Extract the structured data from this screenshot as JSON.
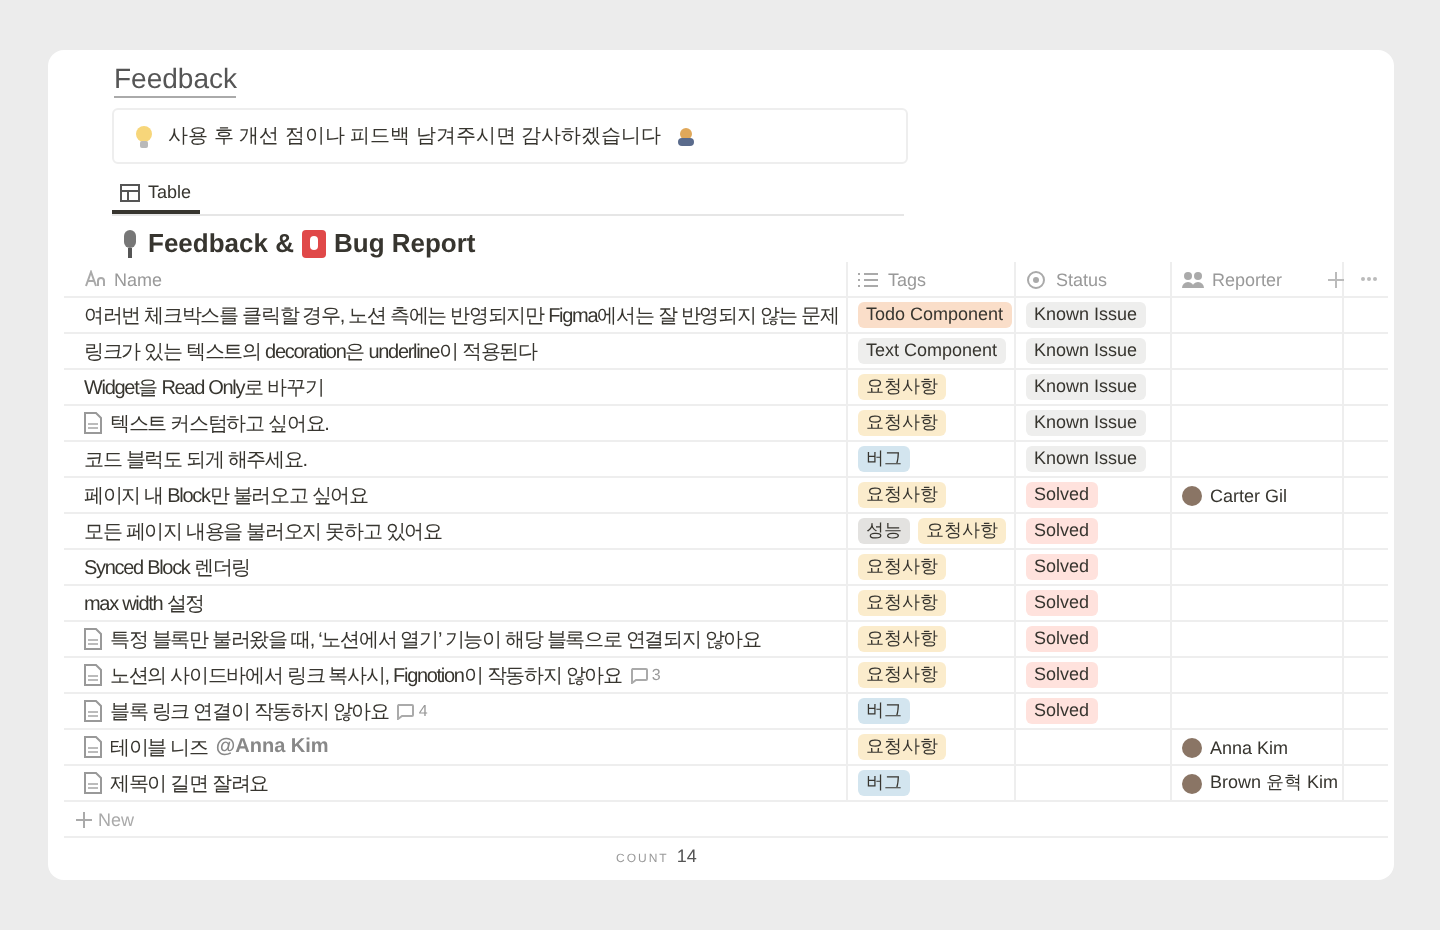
{
  "page": {
    "title": "Feedback"
  },
  "callout": {
    "text": "사용 후 개선 점이나 피드백 남겨주시면 감사하겠습니다"
  },
  "view_tabs": [
    {
      "label": "Table",
      "selected": true
    }
  ],
  "database": {
    "title_parts": [
      "Feedback &",
      "Bug Report"
    ]
  },
  "table": {
    "columns": [
      {
        "label": "Name",
        "kind": "title"
      },
      {
        "label": "Tags",
        "kind": "multi"
      },
      {
        "label": "Status",
        "kind": "status"
      },
      {
        "label": "Reporter",
        "kind": "person"
      }
    ],
    "rows": [
      {
        "name": "여러번 체크박스를 클릭할 경우, 노션 측에는 반영되지만 Figma에서는 잘 반영되지 않는 문제",
        "page_icon": false,
        "tags": [
          {
            "label": "Todo Component",
            "color": "#fadec9"
          }
        ],
        "status": {
          "label": "Known Issue",
          "color": "#eeeeed"
        }
      },
      {
        "name": "링크가 있는 텍스트의 decoration은 underline이 적용된다",
        "page_icon": false,
        "tags": [
          {
            "label": "Text Component",
            "color": "#eeeeed"
          }
        ],
        "status": {
          "label": "Known Issue",
          "color": "#eeeeed"
        }
      },
      {
        "name": "Widget을 Read Only로 바꾸기",
        "page_icon": false,
        "tags": [
          {
            "label": "요청사항",
            "color": "#fbeccc"
          }
        ],
        "status": {
          "label": "Known Issue",
          "color": "#eeeeed"
        }
      },
      {
        "name": "텍스트 커스텀하고 싶어요.",
        "page_icon": true,
        "tags": [
          {
            "label": "요청사항",
            "color": "#fbeccc"
          }
        ],
        "status": {
          "label": "Known Issue",
          "color": "#eeeeed"
        }
      },
      {
        "name": "코드 블럭도 되게 해주세요.",
        "page_icon": false,
        "tags": [
          {
            "label": "버그",
            "color": "#d3e5ef"
          }
        ],
        "status": {
          "label": "Known Issue",
          "color": "#eeeeed"
        }
      },
      {
        "name": "페이지 내 Block만 불러오고 싶어요",
        "page_icon": false,
        "tags": [
          {
            "label": "요청사항",
            "color": "#fbeccc"
          }
        ],
        "status": {
          "label": "Solved",
          "color": "#ffe2dd"
        },
        "reporter": {
          "name": "Carter Gil"
        }
      },
      {
        "name": "모든 페이지 내용을 불러오지 못하고 있어요",
        "page_icon": false,
        "tags": [
          {
            "label": "성능",
            "color": "#e3e2e0"
          },
          {
            "label": "요청사항",
            "color": "#fbeccc"
          }
        ],
        "status": {
          "label": "Solved",
          "color": "#ffe2dd"
        }
      },
      {
        "name": "Synced Block 렌더링",
        "page_icon": false,
        "tags": [
          {
            "label": "요청사항",
            "color": "#fbeccc"
          }
        ],
        "status": {
          "label": "Solved",
          "color": "#ffe2dd"
        }
      },
      {
        "name": "max width 설정",
        "page_icon": false,
        "tags": [
          {
            "label": "요청사항",
            "color": "#fbeccc"
          }
        ],
        "status": {
          "label": "Solved",
          "color": "#ffe2dd"
        }
      },
      {
        "name": "특정 블록만 불러왔을 때, ‘노션에서 열기’ 기능이 해당 블록으로 연결되지 않아요",
        "page_icon": true,
        "tags": [
          {
            "label": "요청사항",
            "color": "#fbeccc"
          }
        ],
        "status": {
          "label": "Solved",
          "color": "#ffe2dd"
        }
      },
      {
        "name": "노션의 사이드바에서 링크 복사시, Fignotion이 작동하지 않아요",
        "page_icon": true,
        "comments": "3",
        "tags": [
          {
            "label": "요청사항",
            "color": "#fbeccc"
          }
        ],
        "status": {
          "label": "Solved",
          "color": "#ffe2dd"
        }
      },
      {
        "name": "블록 링크 연결이 작동하지 않아요",
        "page_icon": true,
        "comments": "4",
        "tags": [
          {
            "label": "버그",
            "color": "#d3e5ef"
          }
        ],
        "status": {
          "label": "Solved",
          "color": "#ffe2dd"
        }
      },
      {
        "name": "테이블 니즈",
        "mention": "@Anna Kim",
        "page_icon": true,
        "tags": [
          {
            "label": "요청사항",
            "color": "#fbeccc"
          }
        ],
        "reporter": {
          "name": "Anna Kim"
        }
      },
      {
        "name": "제목이 길면 잘려요",
        "page_icon": true,
        "tags": [
          {
            "label": "버그",
            "color": "#d3e5ef"
          }
        ],
        "reporter": {
          "name": "Brown 윤혁 Kim"
        }
      }
    ],
    "new_label": "New",
    "count": {
      "label": "COUNT",
      "value": "14"
    }
  }
}
